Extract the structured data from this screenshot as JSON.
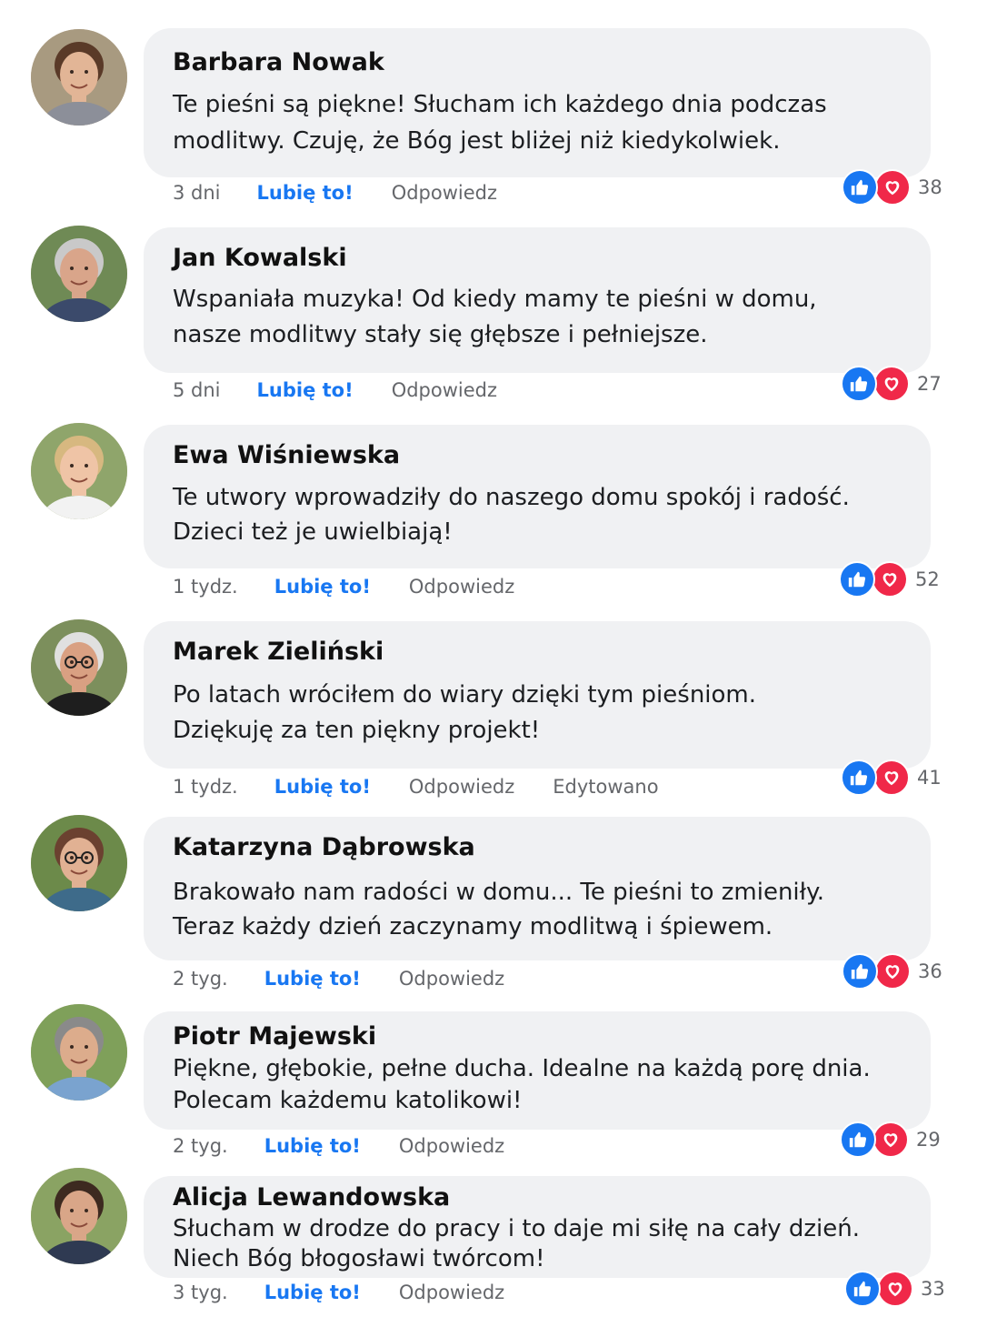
{
  "comments": [
    {
      "name": "Barbara Nowak",
      "lines": [
        "Te pieśni są piękne! Słucham ich każdego dnia podczas",
        "modlitwy. Czuję, że Bóg jest bliżej niż kiedykolwiek."
      ],
      "time": "3 dni",
      "like": "Lubię to!",
      "reply": "Odpowiedz",
      "edited": "",
      "count": "38",
      "avatar": "female-avatar-dark-hair"
    },
    {
      "name": "Jan Kowalski",
      "lines": [
        "Wspaniała muzyka! Od kiedy mamy te pieśni w domu,",
        "nasze modlitwy stały się głębsze i pełniejsze."
      ],
      "time": "5 dni",
      "like": "Lubię to!",
      "reply": "Odpowiedz",
      "edited": "",
      "count": "27",
      "avatar": "male-avatar-grey-hair"
    },
    {
      "name": "Ewa Wiśniewska",
      "lines": [
        "Te utwory wprowadziły do naszego domu spokój i radość.",
        "Dzieci też je uwielbiają!"
      ],
      "time": "1 tydz.",
      "like": "Lubię to!",
      "reply": "Odpowiedz",
      "edited": "",
      "count": "52",
      "avatar": "female-avatar-blonde-hair"
    },
    {
      "name": "Marek Zieliński",
      "lines": [
        "Po latach wróciłem do wiary dzięki tym pieśniom.",
        "Dziękuję za ten piękny projekt!"
      ],
      "time": "1 tydz.",
      "like": "Lubię to!",
      "reply": "Odpowiedz",
      "edited": "Edytowano",
      "count": "41",
      "avatar": "male-avatar-glasses"
    },
    {
      "name": "Katarzyna Dąbrowska",
      "lines": [
        "Brakowało nam radości w domu... Te pieśni to zmieniły.",
        "Teraz każdy dzień zaczynamy modlitwą i śpiewem."
      ],
      "time": "2 tyg.",
      "like": "Lubię to!",
      "reply": "Odpowiedz",
      "edited": "",
      "count": "36",
      "avatar": "female-avatar-glasses"
    },
    {
      "name": "Piotr Majewski",
      "lines": [
        "Piękne, głębokie, pełne ducha. Idealne na każdą porę dnia.",
        "Polecam każdemu katolikowi!"
      ],
      "time": "2 tyg.",
      "like": "Lubię to!",
      "reply": "Odpowiedz",
      "edited": "",
      "count": "29",
      "avatar": "male-avatar-smiling"
    },
    {
      "name": "Alicja Lewandowska",
      "lines": [
        "Słucham w drodze do pracy i to daje mi siłę na cały dzień.",
        "Niech Bóg błogosławi twórcom!"
      ],
      "time": "3 tyg.",
      "like": "Lubię to!",
      "reply": "Odpowiedz",
      "edited": "",
      "count": "33",
      "avatar": "female-avatar-brown-hair"
    }
  ],
  "colors": {
    "accent": "#1877f2",
    "heart": "#f02849",
    "bubble": "#f0f1f3",
    "meta": "#65676b"
  }
}
